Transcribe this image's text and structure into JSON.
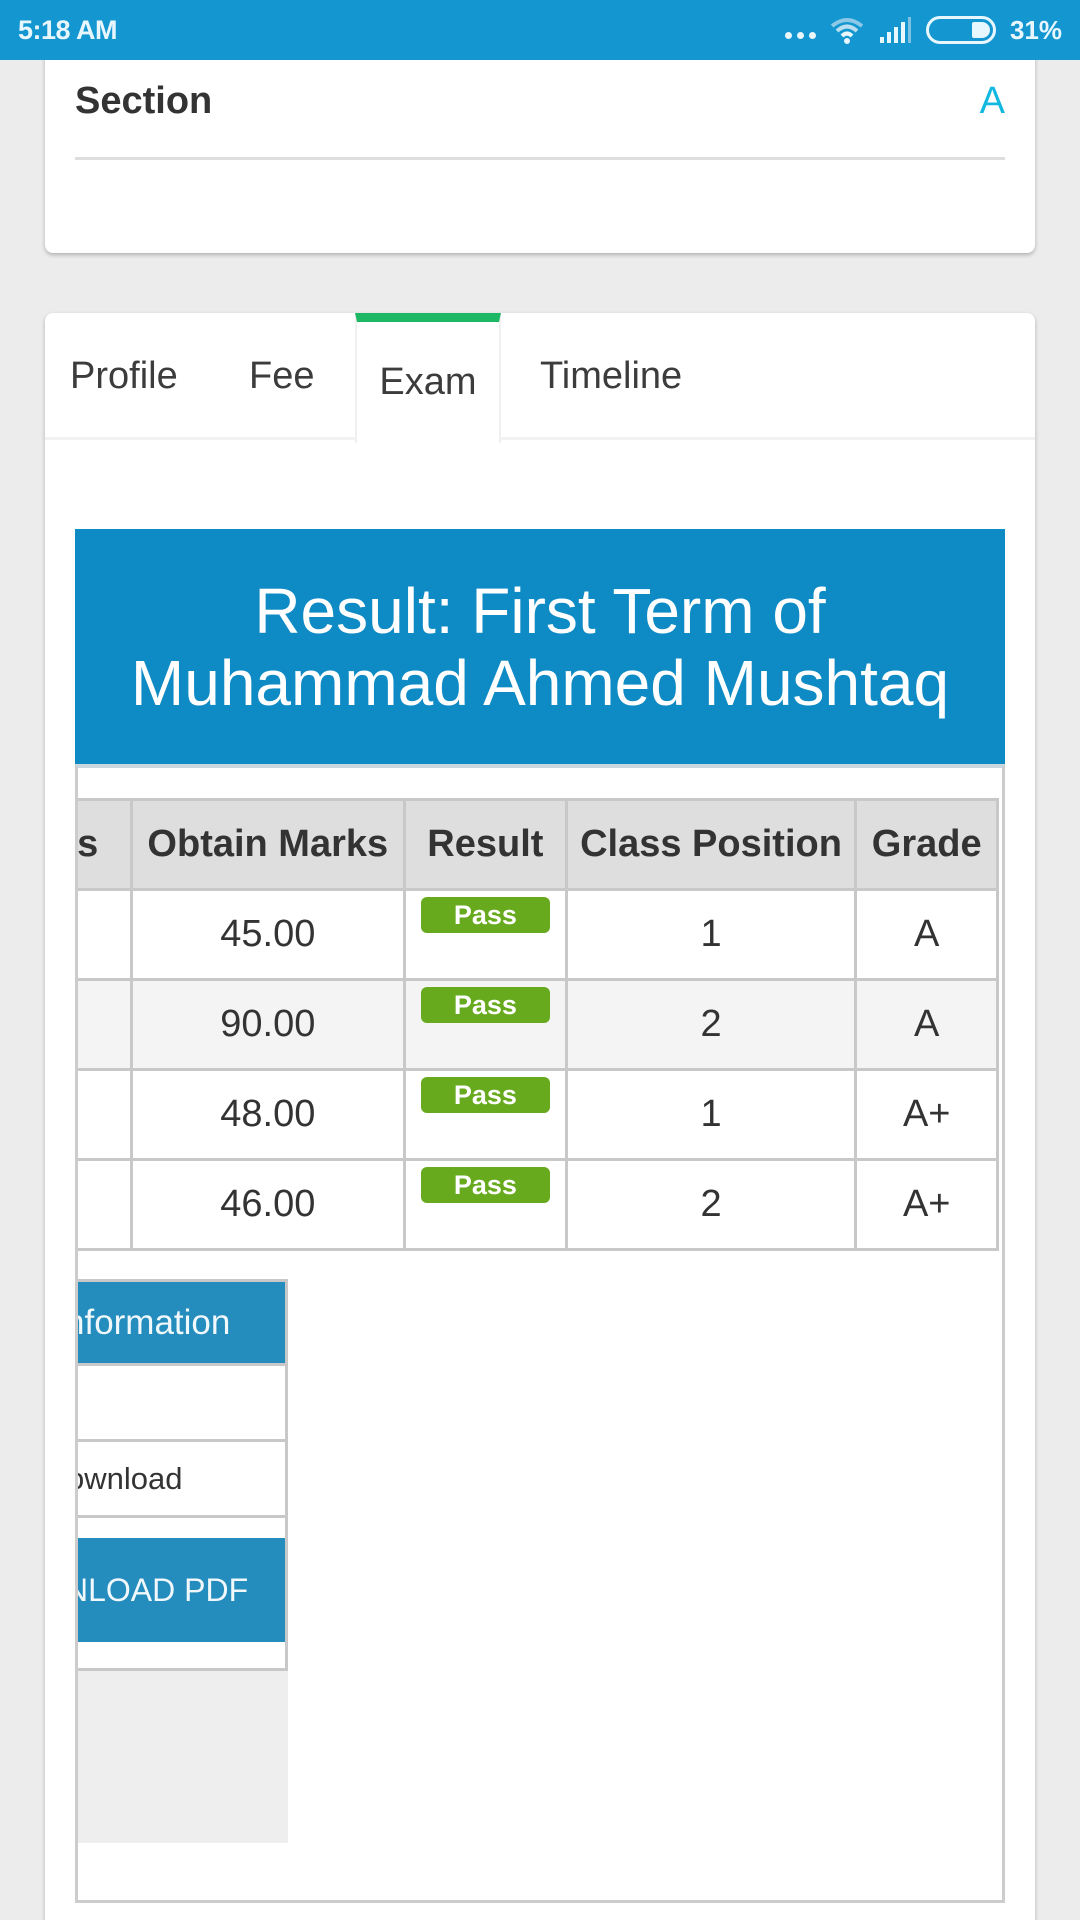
{
  "status_bar": {
    "time": "5:18 AM",
    "battery_percent": "31%",
    "battery_level": 0.31,
    "icons": [
      "more-dots-icon",
      "wifi-icon",
      "signal-icon",
      "battery-icon"
    ]
  },
  "section_card": {
    "label": "Section",
    "value": "A",
    "value_color": "#12b8e0"
  },
  "tabs": [
    {
      "label": "Profile",
      "active": false
    },
    {
      "label": "Fee",
      "active": false
    },
    {
      "label": "Exam",
      "active": true
    },
    {
      "label": "Timeline",
      "active": false
    }
  ],
  "result": {
    "title": "Result: First Term of Muhammad Ahmed Mushtaq",
    "header_color": "#0e8ac4",
    "columns": [
      "ks",
      "Obtain Marks",
      "Result",
      "Class Position",
      "Grade"
    ],
    "rows": [
      {
        "obtain_marks": "45.00",
        "result": "Pass",
        "class_position": "1",
        "grade": "A"
      },
      {
        "obtain_marks": "90.00",
        "result": "Pass",
        "class_position": "2",
        "grade": "A"
      },
      {
        "obtain_marks": "48.00",
        "result": "Pass",
        "class_position": "1",
        "grade": "A+"
      },
      {
        "obtain_marks": "46.00",
        "result": "Pass",
        "class_position": "2",
        "grade": "A+"
      }
    ],
    "pass_color": "#67aa1e"
  },
  "info_panel": {
    "header": "nformation",
    "download_label": "ownload",
    "pdf_button": "NLOAD PDF"
  },
  "colors": {
    "status_bar": "#1497d0",
    "active_tab_indicator": "#1db866",
    "info_blue": "#258dbd"
  }
}
